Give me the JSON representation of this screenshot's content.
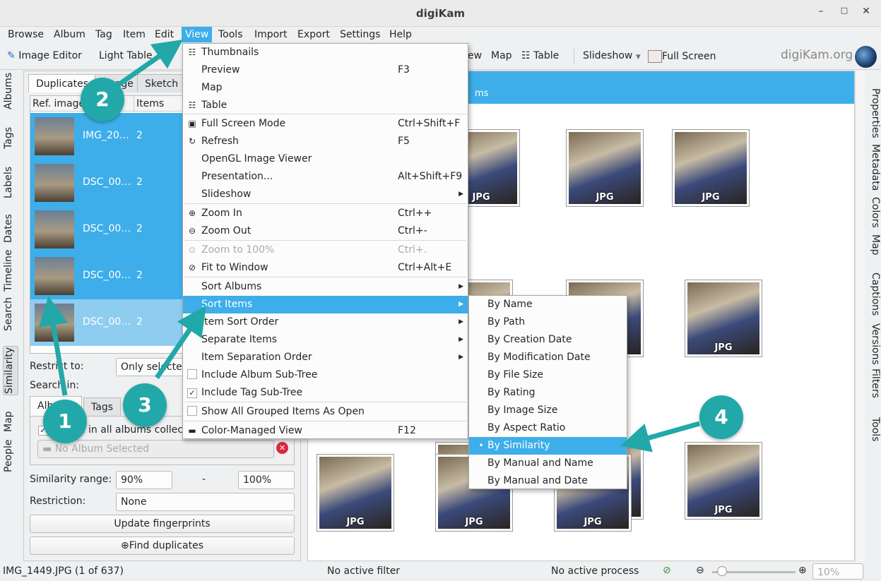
{
  "window": {
    "title": "digiKam",
    "controls": [
      "minimize",
      "maximize",
      "close"
    ]
  },
  "menubar": [
    "Browse",
    "Album",
    "Tag",
    "Item",
    "Edit",
    "View",
    "Tools",
    "Import",
    "Export",
    "Settings",
    "Help"
  ],
  "toolbar": {
    "image_editor": "Image Editor",
    "light_table": "Light Table",
    "preview_partial": "ew",
    "map": "Map",
    "table": "Table",
    "slideshow": "Slideshow",
    "full_screen": "Full Screen",
    "brand": "digiKam.org"
  },
  "left_tabs": [
    "Albums",
    "Tags",
    "Labels",
    "Dates",
    "Timeline",
    "Search",
    "Similarity",
    "Map",
    "People"
  ],
  "right_tabs": [
    "Properties",
    "Metadata",
    "Colors",
    "Map",
    "Captions",
    "Versions",
    "Filters",
    "Tools"
  ],
  "similarity": {
    "tabs": [
      "Duplicates",
      "Image",
      "Sketch"
    ],
    "columns": [
      "Ref. image",
      "Items"
    ],
    "rows": [
      {
        "name": "IMG_20…",
        "items": "2"
      },
      {
        "name": "DSC_00…",
        "items": "2"
      },
      {
        "name": "DSC_00…",
        "items": "2"
      },
      {
        "name": "DSC_00…",
        "items": "2"
      },
      {
        "name": "DSC_00…",
        "items": "2"
      }
    ],
    "restrict_label": "Restrict to:",
    "restrict_value": "Only selected",
    "search_in_label": "Search in:",
    "search_tabs": [
      "Albums",
      "Tags"
    ],
    "collection_checkbox": "Search in all albums collection",
    "album_placeholder": "No Album Selected",
    "range_label": "Similarity range:",
    "range_min": "90%",
    "range_dash": "-",
    "range_max": "100%",
    "restriction_label": "Restriction:",
    "restriction_value": "None",
    "update_button": "Update fingerprints",
    "find_button": "Find duplicates"
  },
  "main": {
    "header_line2": "ms",
    "thumb_label": "JPG"
  },
  "view_menu": [
    {
      "label": "Thumbnails",
      "icon": "thumbnails-icon"
    },
    {
      "label": "Preview",
      "shortcut": "F3"
    },
    {
      "label": "Map"
    },
    {
      "label": "Table",
      "icon": "table-icon"
    },
    {
      "label": "Full Screen Mode",
      "shortcut": "Ctrl+Shift+F",
      "icon": "fullscreen-icon"
    },
    {
      "label": "Refresh",
      "shortcut": "F5",
      "icon": "refresh-icon"
    },
    {
      "label": "OpenGL Image Viewer"
    },
    {
      "label": "Presentation...",
      "shortcut": "Alt+Shift+F9"
    },
    {
      "label": "Slideshow",
      "submenu": true
    },
    {
      "label": "Zoom In",
      "shortcut": "Ctrl++",
      "icon": "zoom-in-icon"
    },
    {
      "label": "Zoom Out",
      "shortcut": "Ctrl+-",
      "icon": "zoom-out-icon"
    },
    {
      "label": "Zoom to 100%",
      "shortcut": "Ctrl+.",
      "disabled": true,
      "icon": "zoom-100-icon"
    },
    {
      "label": "Fit to Window",
      "shortcut": "Ctrl+Alt+E",
      "icon": "fit-window-icon"
    },
    {
      "label": "Sort Albums",
      "submenu": true
    },
    {
      "label": "Sort Items",
      "submenu": true,
      "highlighted": true
    },
    {
      "label": "Item Sort Order",
      "submenu": true
    },
    {
      "label": "Separate Items",
      "submenu": true
    },
    {
      "label": "Item Separation Order",
      "submenu": true
    },
    {
      "label": "Include Album Sub-Tree",
      "checked": false
    },
    {
      "label": "Include Tag Sub-Tree",
      "checked": true
    },
    {
      "label": "Show All Grouped Items As Open",
      "checked": false
    },
    {
      "label": "Color-Managed View",
      "shortcut": "F12",
      "icon": "monitor-icon"
    }
  ],
  "sort_submenu": [
    "By Name",
    "By Path",
    "By Creation Date",
    "By Modification Date",
    "By File Size",
    "By Rating",
    "By Image Size",
    "By Aspect Ratio",
    "By Similarity",
    "By Manual and Name",
    "By Manual and Date"
  ],
  "sort_selected": "By Similarity",
  "annotations": [
    "1",
    "2",
    "3",
    "4"
  ],
  "annotation_color": "#22a8a8",
  "accent": "#3daee9",
  "status": {
    "file": "IMG_1449.JPG (1 of 637)",
    "filter": "No active filter",
    "process": "No active process",
    "zoom": "10%"
  }
}
